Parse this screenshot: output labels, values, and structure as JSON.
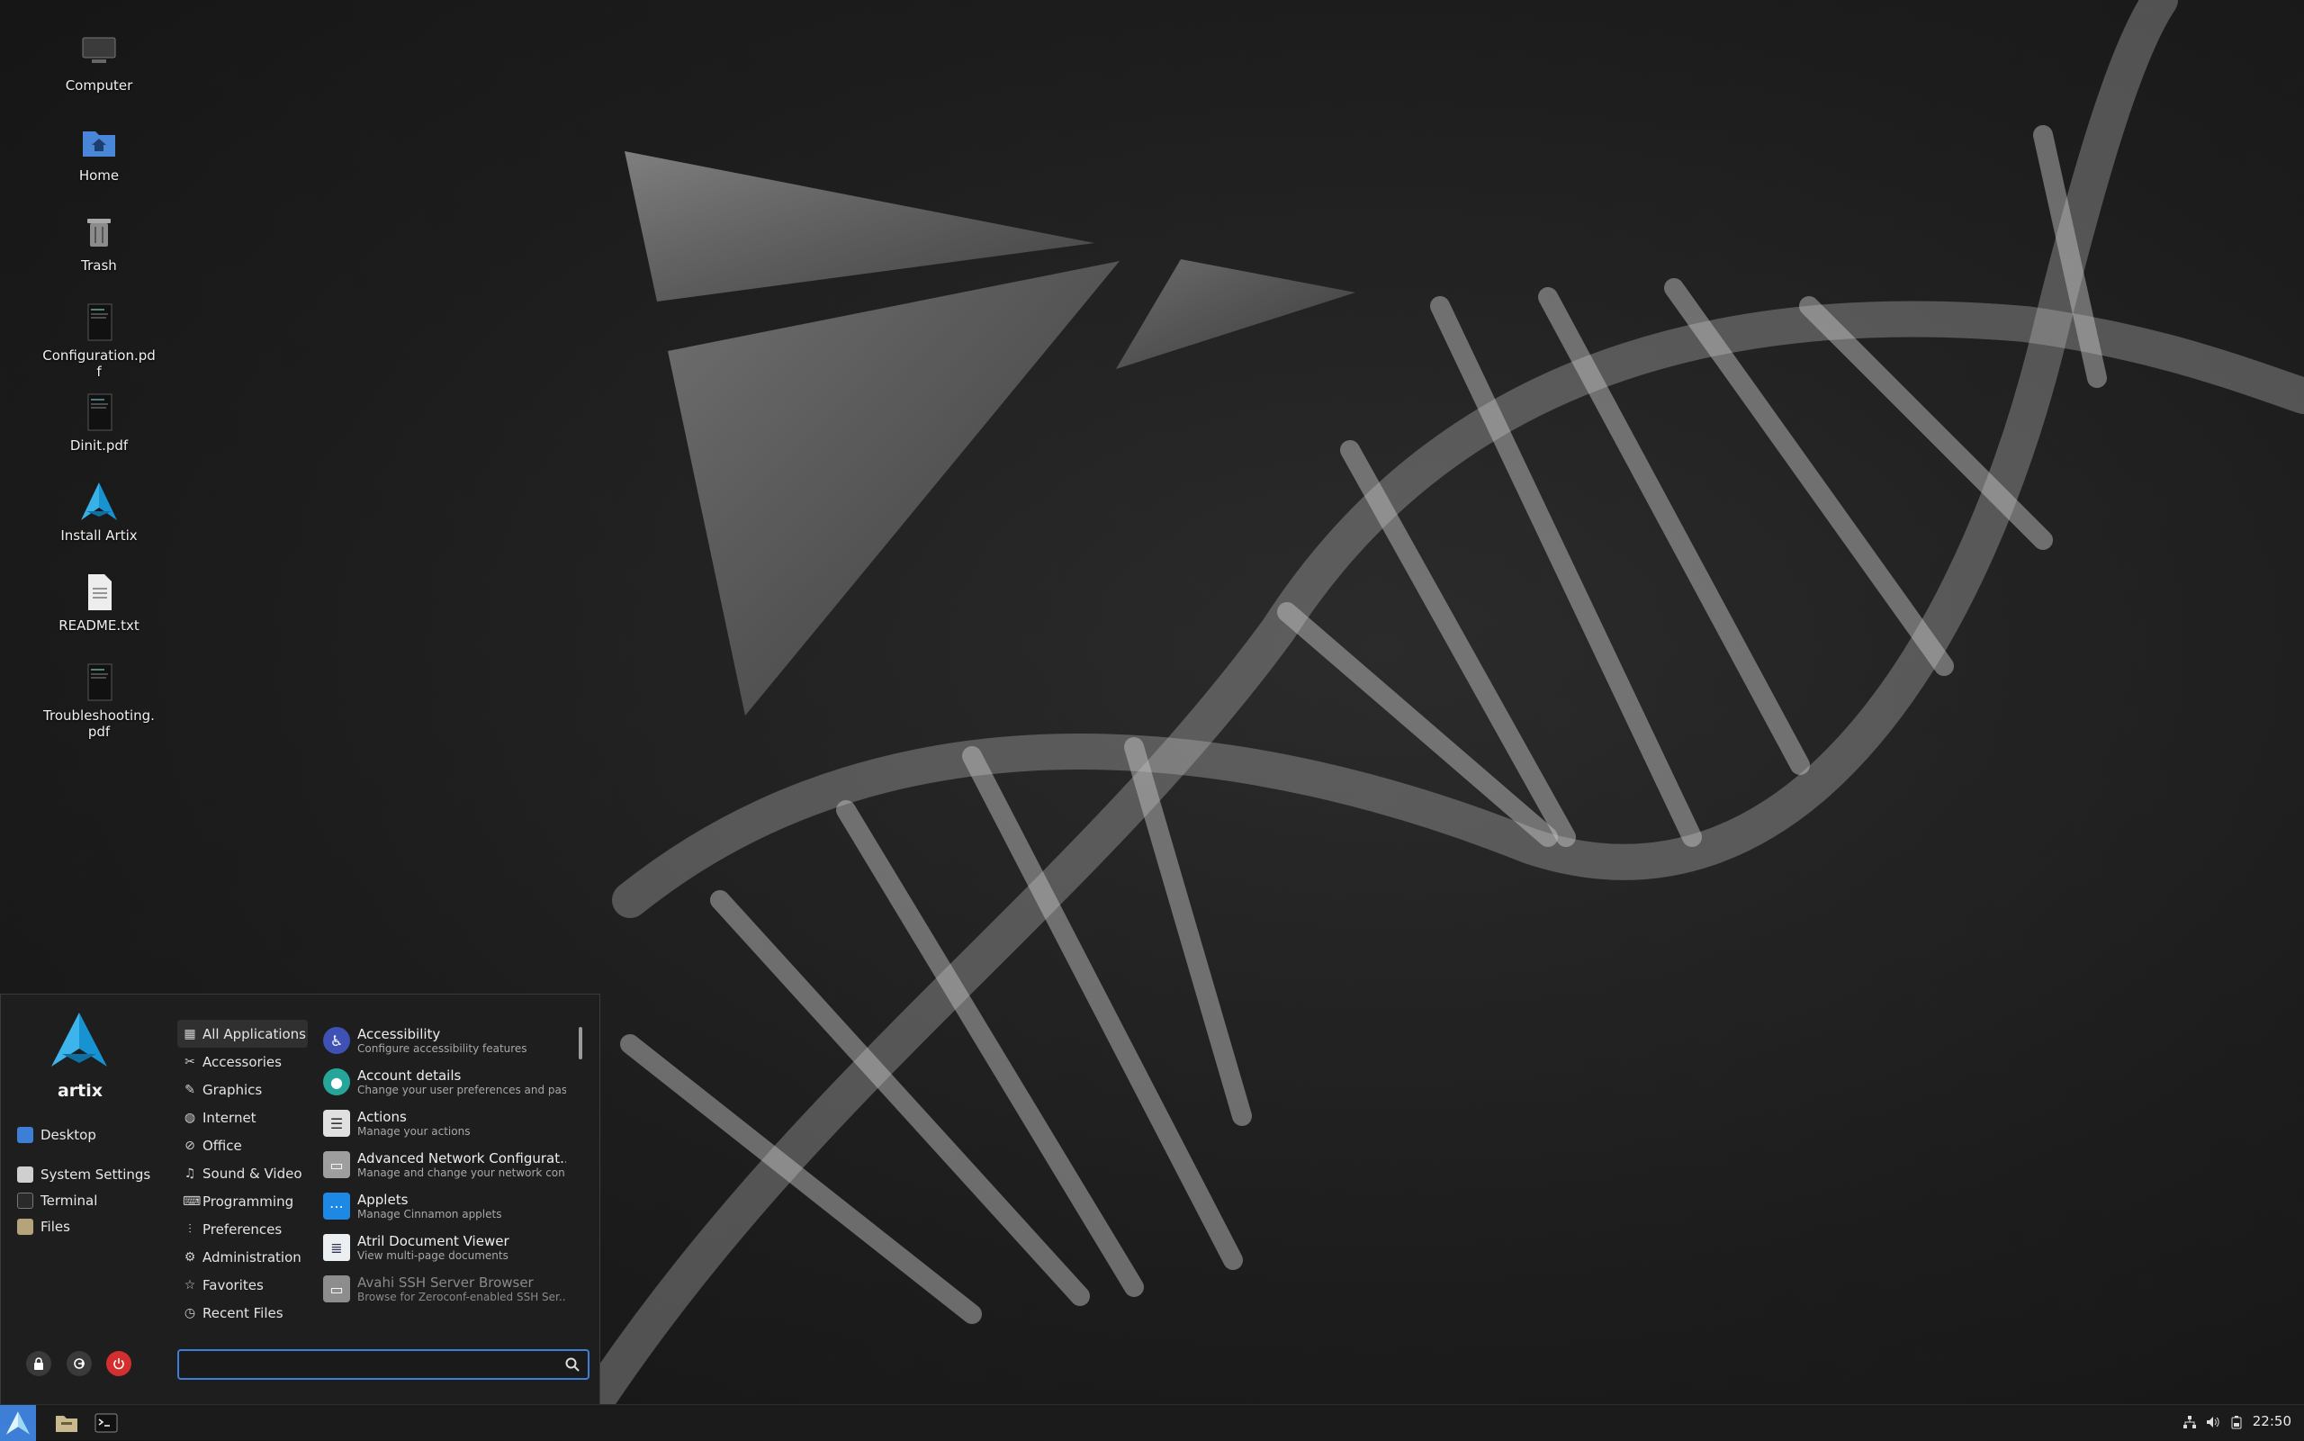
{
  "desktop": {
    "icons": [
      {
        "label": "Computer",
        "icon": "computer-icon"
      },
      {
        "label": "Home",
        "icon": "home-folder-icon"
      },
      {
        "label": "Trash",
        "icon": "trash-icon"
      },
      {
        "label": "Configuration.pdf",
        "icon": "pdf-document-icon"
      },
      {
        "label": "Dinit.pdf",
        "icon": "pdf-document-icon"
      },
      {
        "label": "Install Artix",
        "icon": "artix-install-icon"
      },
      {
        "label": "README.txt",
        "icon": "text-file-icon"
      },
      {
        "label": "Troubleshooting.pdf",
        "icon": "pdf-document-icon"
      }
    ]
  },
  "menu": {
    "brand": "artix",
    "places": [
      {
        "label": "Desktop",
        "icon": "desktop-folder-icon"
      },
      {
        "label": "System Settings",
        "icon": "settings-icon"
      },
      {
        "label": "Terminal",
        "icon": "terminal-icon"
      },
      {
        "label": "Files",
        "icon": "files-icon"
      }
    ],
    "categories": [
      {
        "label": "All Applications",
        "icon": "grid-icon",
        "active": true
      },
      {
        "label": "Accessories",
        "icon": "tools-icon"
      },
      {
        "label": "Graphics",
        "icon": "palette-icon"
      },
      {
        "label": "Internet",
        "icon": "globe-icon"
      },
      {
        "label": "Office",
        "icon": "paperclip-icon"
      },
      {
        "label": "Sound & Video",
        "icon": "media-icon"
      },
      {
        "label": "Programming",
        "icon": "code-icon"
      },
      {
        "label": "Preferences",
        "icon": "sliders-icon"
      },
      {
        "label": "Administration",
        "icon": "gear-icon"
      },
      {
        "label": "Favorites",
        "icon": "star-icon"
      },
      {
        "label": "Recent Files",
        "icon": "clock-icon"
      }
    ],
    "apps": [
      {
        "name": "Accessibility",
        "desc": "Configure accessibility features",
        "color": "#3f51b5"
      },
      {
        "name": "Account details",
        "desc": "Change your user preferences and pas...",
        "color": "#26a69a"
      },
      {
        "name": "Actions",
        "desc": "Manage your actions",
        "color": "#e0e0e0"
      },
      {
        "name": "Advanced Network Configurat...",
        "desc": "Manage and change your network con...",
        "color": "#9e9e9e"
      },
      {
        "name": "Applets",
        "desc": "Manage Cinnamon applets",
        "color": "#1e88e5"
      },
      {
        "name": "Atril Document Viewer",
        "desc": "View multi-page documents",
        "color": "#eceff1"
      },
      {
        "name": "Avahi SSH Server Browser",
        "desc": "Browse for Zeroconf-enabled SSH Ser...",
        "color": "#8d8d8d",
        "dim": true
      }
    ],
    "search_placeholder": "",
    "session_buttons": [
      {
        "name": "lock-icon",
        "color": "#3a3a3a"
      },
      {
        "name": "logout-icon",
        "color": "#3a3a3a"
      },
      {
        "name": "power-icon",
        "color": "#d32f2f"
      }
    ]
  },
  "panel": {
    "clock": "22:50",
    "tray_icons": [
      "network-icon",
      "volume-icon",
      "battery-icon"
    ],
    "tasks": [
      "file-manager-icon",
      "terminal-icon"
    ]
  }
}
